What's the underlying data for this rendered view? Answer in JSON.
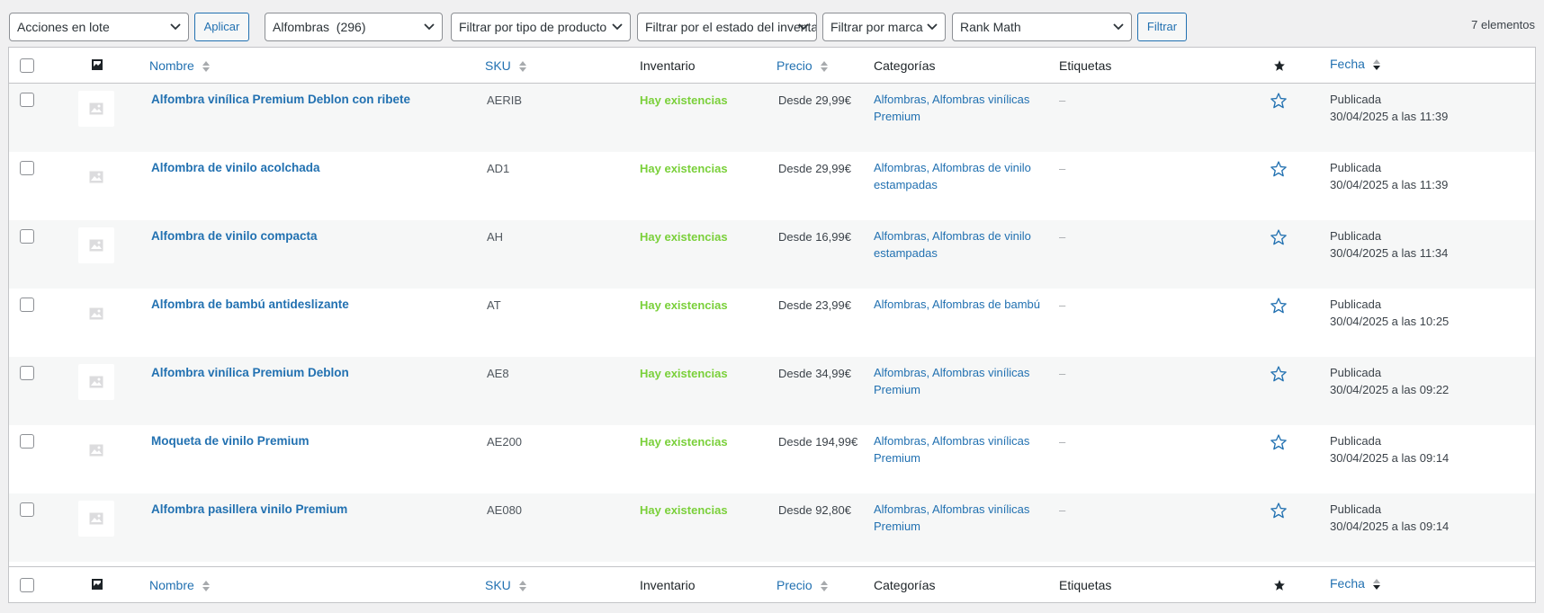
{
  "toolbar": {
    "bulk_actions": "Acciones en lote",
    "apply_label": "Aplicar",
    "category_filter": "Alfombras  (296)",
    "type_filter": "Filtrar por tipo de producto",
    "stock_filter": "Filtrar por el estado del inventario",
    "brand_filter": "Filtrar por marca",
    "seo_filter": "Rank Math",
    "filter_label": "Filtrar",
    "item_count": "7 elementos"
  },
  "columns": {
    "name": "Nombre",
    "sku": "SKU",
    "inventory": "Inventario",
    "price": "Precio",
    "categories": "Categorías",
    "tags": "Etiquetas",
    "date": "Fecha"
  },
  "products": [
    {
      "name": "Alfombra vinílica Premium Deblon con ribete",
      "sku": "AERIB",
      "stock": "Hay existencias",
      "price": "Desde 29,99€",
      "categories": "Alfombras, Alfombras vinílicas Premium",
      "tags": "–",
      "status": "Publicada",
      "date": "30/04/2025 a las 11:39"
    },
    {
      "name": "Alfombra de vinilo acolchada",
      "sku": "AD1",
      "stock": "Hay existencias",
      "price": "Desde 29,99€",
      "categories": "Alfombras, Alfombras de vinilo estampadas",
      "tags": "–",
      "status": "Publicada",
      "date": "30/04/2025 a las 11:39"
    },
    {
      "name": "Alfombra de vinilo compacta",
      "sku": "AH",
      "stock": "Hay existencias",
      "price": "Desde 16,99€",
      "categories": "Alfombras, Alfombras de vinilo estampadas",
      "tags": "–",
      "status": "Publicada",
      "date": "30/04/2025 a las 11:34"
    },
    {
      "name": "Alfombra de bambú antideslizante",
      "sku": "AT",
      "stock": "Hay existencias",
      "price": "Desde 23,99€",
      "categories": "Alfombras, Alfombras de bambú",
      "tags": "–",
      "status": "Publicada",
      "date": "30/04/2025 a las 10:25"
    },
    {
      "name": "Alfombra vinílica Premium Deblon",
      "sku": "AE8",
      "stock": "Hay existencias",
      "price": "Desde 34,99€",
      "categories": "Alfombras, Alfombras vinílicas Premium",
      "tags": "–",
      "status": "Publicada",
      "date": "30/04/2025 a las 09:22"
    },
    {
      "name": "Moqueta de vinilo Premium",
      "sku": "AE200",
      "stock": "Hay existencias",
      "price": "Desde 194,99€",
      "categories": "Alfombras, Alfombras vinílicas Premium",
      "tags": "–",
      "status": "Publicada",
      "date": "30/04/2025 a las 09:14"
    },
    {
      "name": "Alfombra pasillera vinilo Premium",
      "sku": "AE080",
      "stock": "Hay existencias",
      "price": "Desde 92,80€",
      "categories": "Alfombras, Alfombras vinílicas Premium",
      "tags": "–",
      "status": "Publicada",
      "date": "30/04/2025 a las 09:14"
    }
  ],
  "colors": {
    "link": "#2271b1",
    "in_stock": "#7ad03a",
    "row_alt": "#f6f7f7",
    "border": "#c3c4c7"
  },
  "icons": {
    "image_column": "image-icon",
    "featured_column": "star-filled-icon",
    "row_featured": "star-outline-icon",
    "sort": "sort-arrows-icon",
    "sort_desc": "sort-desc-icon",
    "select": "chevron-down-icon",
    "placeholder": "image-placeholder-icon"
  }
}
